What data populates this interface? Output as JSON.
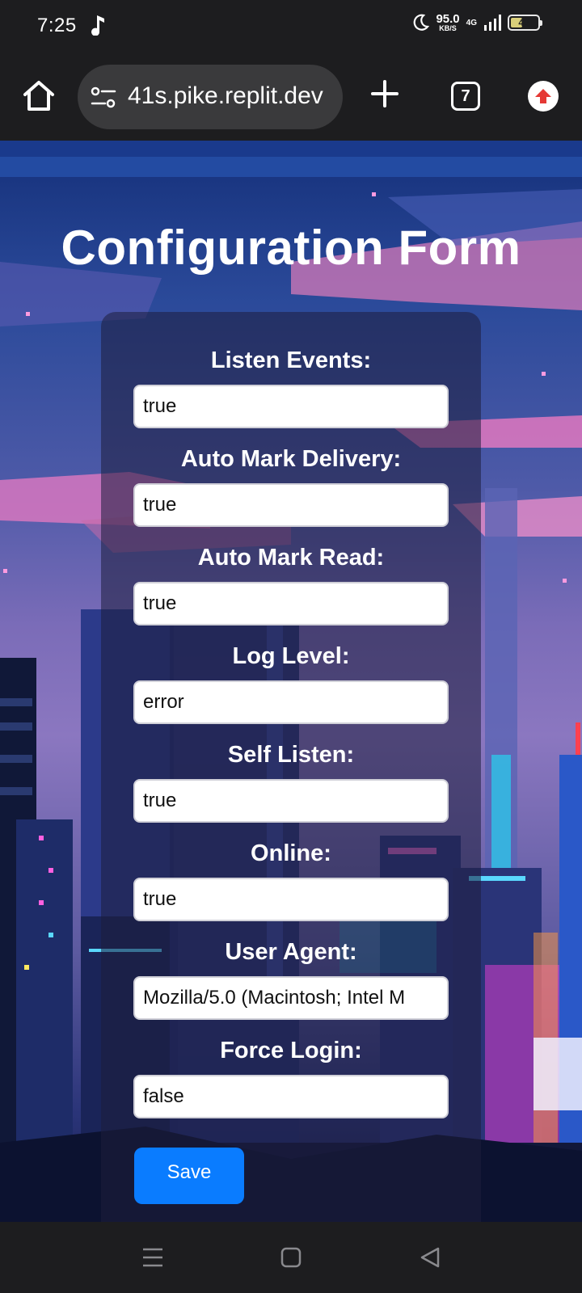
{
  "status_bar": {
    "time": "7:25",
    "net_speed_value": "95.0",
    "net_speed_unit": "KB/S",
    "network": "4G",
    "battery_level": "43",
    "icons": [
      "music-note-icon",
      "moon-icon",
      "signal-icon",
      "battery-icon"
    ]
  },
  "browser": {
    "url": "41s.pike.replit.dev",
    "tab_count": "7",
    "icons": [
      "home-icon",
      "site-settings-icon",
      "new-tab-icon",
      "tabs-icon",
      "update-icon"
    ]
  },
  "page": {
    "title": "Configuration Form",
    "fields": [
      {
        "label": "Listen Events:",
        "value": "true"
      },
      {
        "label": "Auto Mark Delivery:",
        "value": "true"
      },
      {
        "label": "Auto Mark Read:",
        "value": "true"
      },
      {
        "label": "Log Level:",
        "value": "error"
      },
      {
        "label": "Self Listen:",
        "value": "true"
      },
      {
        "label": "Online:",
        "value": "true"
      },
      {
        "label": "User Agent:",
        "value": "Mozilla/5.0 (Macintosh; Intel M"
      },
      {
        "label": "Force Login:",
        "value": "false"
      }
    ],
    "save_label": "Save",
    "save_color": "#0a7cff"
  },
  "nav_bar": {
    "icons": [
      "menu-icon",
      "home-square-icon",
      "back-icon"
    ]
  }
}
